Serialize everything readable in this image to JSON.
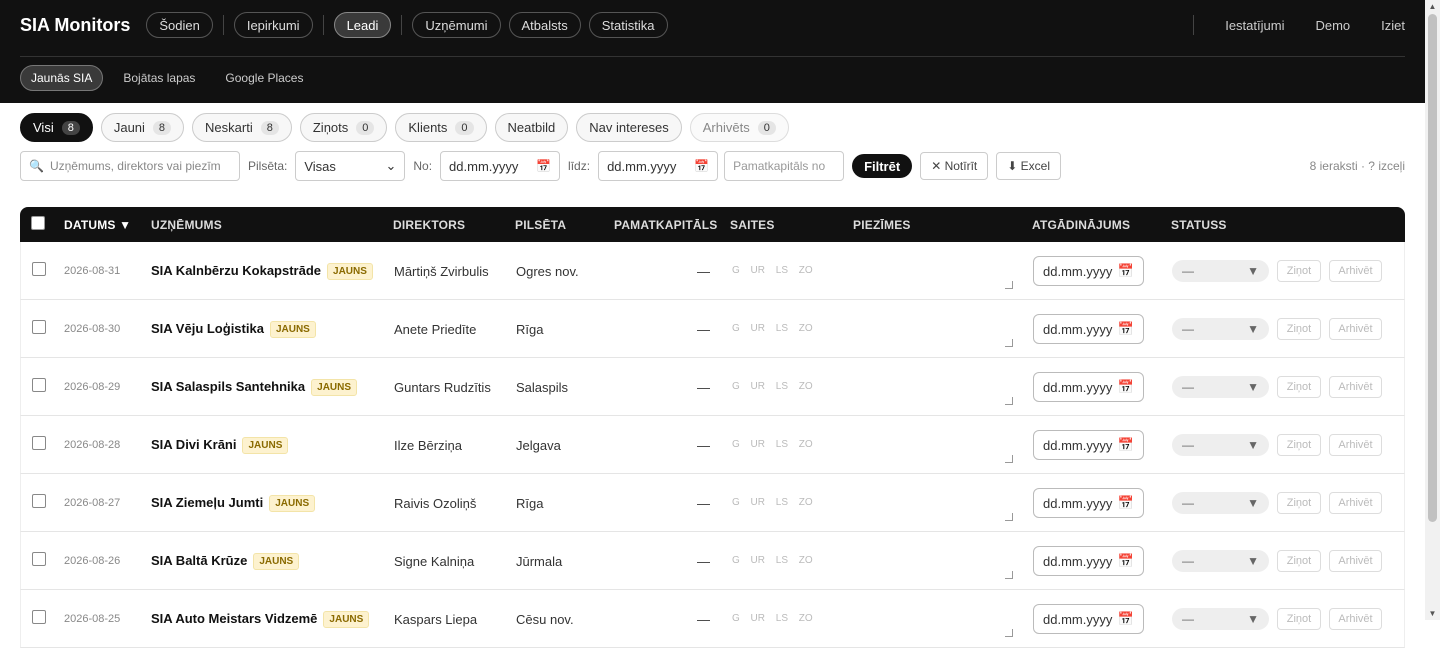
{
  "app": {
    "brand": "SIA Monitors"
  },
  "nav": {
    "left": [
      "Šodien",
      "Iepirkumi",
      "Leadi",
      "Uzņēmumi",
      "Atbalsts",
      "Statistika"
    ],
    "active_index": 2,
    "right": [
      "Iestatījumi",
      "Demo",
      "Iziet"
    ]
  },
  "subnav": {
    "items": [
      "Jaunās SIA",
      "Bojātas lapas",
      "Google Places"
    ],
    "active_index": 0
  },
  "filters": {
    "chips": [
      {
        "label": "Visi",
        "count": "8"
      },
      {
        "label": "Jauni",
        "count": "8"
      },
      {
        "label": "Neskarti",
        "count": "8"
      },
      {
        "label": "Ziņots",
        "count": "0"
      },
      {
        "label": "Klients",
        "count": "0"
      },
      {
        "label": "Neatbild",
        "count": ""
      },
      {
        "label": "Nav intereses",
        "count": ""
      },
      {
        "label": "Arhivēts",
        "count": "0"
      }
    ]
  },
  "search": {
    "placeholder": "Uzņēmums, direktors vai piezīm",
    "city_label": "Pilsēta:",
    "city_value": "Visas",
    "from_label": "No:",
    "to_label": "līdz:",
    "date_placeholder": "dd.mm.yyyy",
    "capital_placeholder": "Pamatkapitāls no",
    "filter_button": "Filtrēt",
    "clear_button": "Notīrīt",
    "excel_button": "Excel",
    "count_info": "8 ieraksti · ? izceļi"
  },
  "table": {
    "headers": {
      "date": "DATUMS ▼",
      "company": "UZŅĒMUMS",
      "director": "DIREKTORS",
      "city": "PILSĒTA",
      "capital": "PAMATKAPITĀLS",
      "links": "SAITES",
      "notes": "PIEZĪMES",
      "reminder": "ATGĀDINĀJUMS",
      "status": "STATUSS"
    },
    "badge_label": "JAUNS",
    "links_text": "G UR LS ZO",
    "status_value": "—",
    "report_label": "Ziņot",
    "archive_label": "Arhivēt",
    "rows": [
      {
        "date": "2026-08-31",
        "company": "SIA Kalnbērzu Kokapstrāde",
        "director": "Mārtiņš Zvirbulis",
        "city": "Ogres nov.",
        "capital": "—"
      },
      {
        "date": "2026-08-30",
        "company": "SIA Vēju Loģistika",
        "director": "Anete Priedīte",
        "city": "Rīga",
        "capital": "—"
      },
      {
        "date": "2026-08-29",
        "company": "SIA Salaspils Santehnika",
        "director": "Guntars Rudzītis",
        "city": "Salaspils",
        "capital": "—"
      },
      {
        "date": "2026-08-28",
        "company": "SIA Divi Krāni",
        "director": "Ilze Bērziņa",
        "city": "Jelgava",
        "capital": "—"
      },
      {
        "date": "2026-08-27",
        "company": "SIA Ziemeļu Jumti",
        "director": "Raivis Ozoliņš",
        "city": "Rīga",
        "capital": "—"
      },
      {
        "date": "2026-08-26",
        "company": "SIA Baltā Krūze",
        "director": "Signe Kalniņa",
        "city": "Jūrmala",
        "capital": "—"
      },
      {
        "date": "2026-08-25",
        "company": "SIA Auto Meistars Vidzemē",
        "director": "Kaspars Liepa",
        "city": "Cēsu nov.",
        "capital": "—"
      }
    ]
  }
}
